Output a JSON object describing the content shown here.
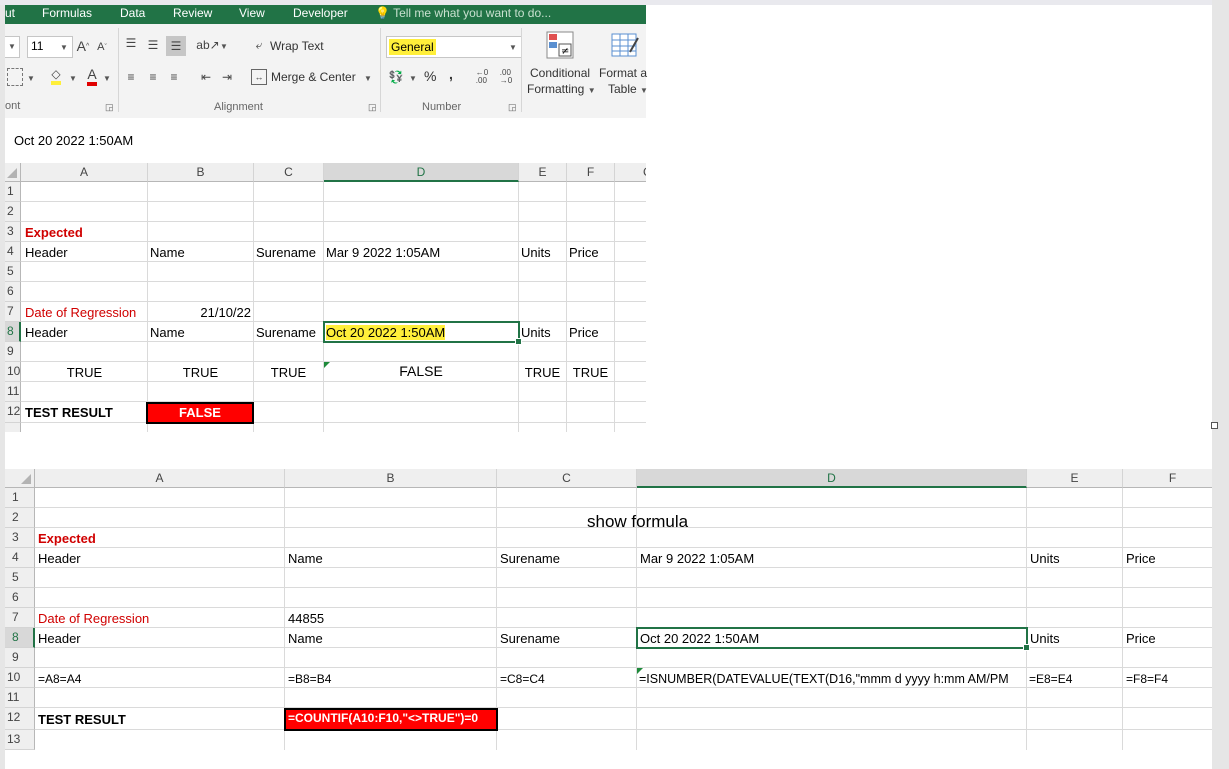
{
  "ribbon": {
    "tabs": [
      "ut",
      "Formulas",
      "Data",
      "Review",
      "View",
      "Developer"
    ],
    "tell_me": "Tell me what you want to do...",
    "font_size": "11",
    "wrap_text": "Wrap Text",
    "merge_center": "Merge & Center",
    "number_format": "General",
    "conditional_formatting_1": "Conditional",
    "conditional_formatting_2": "Formatting",
    "format_as_table_1": "Format a",
    "format_as_table_2": "Table",
    "group_font": "ont",
    "group_alignment": "Alignment",
    "group_number": "Number",
    "percent": "%",
    "comma": ","
  },
  "formula_bar": {
    "value": "Oct 20 2022 1:50AM"
  },
  "sheet1": {
    "columns": [
      "A",
      "B",
      "C",
      "D",
      "E",
      "F",
      "G"
    ],
    "rows": [
      "1",
      "2",
      "3",
      "4",
      "5",
      "6",
      "7",
      "8",
      "9",
      "10",
      "11",
      "12"
    ],
    "a3": "Expected",
    "a4": "Header",
    "b4": "Name",
    "c4": "Surename",
    "d4": "Mar 9 2022 1:05AM",
    "e4": "Units",
    "f4": "Price",
    "a7": "Date of Regression",
    "b7": "21/10/22",
    "a8": "Header",
    "b8": "Name",
    "c8": "Surename",
    "d8": "Oct 20 2022 1:50AM",
    "e8": "Units",
    "f8": "Price",
    "a10": "TRUE",
    "b10": "TRUE",
    "c10": "TRUE",
    "d10": "FALSE",
    "e10": "TRUE",
    "f10": "TRUE",
    "a12": "TEST RESULT",
    "b12": "FALSE"
  },
  "sheet2": {
    "columns": [
      "A",
      "B",
      "C",
      "D",
      "E",
      "F"
    ],
    "rows": [
      "1",
      "2",
      "3",
      "4",
      "5",
      "6",
      "7",
      "8",
      "9",
      "10",
      "11",
      "12",
      "13"
    ],
    "c2": "show formula",
    "a3": "Expected",
    "a4": "Header",
    "b4": "Name",
    "c4": "Surename",
    "d4": "Mar 9 2022 1:05AM",
    "e4": "Units",
    "f4": "Price",
    "a7": "Date of Regression",
    "b7": "44855",
    "a8": "Header",
    "b8": "Name",
    "c8": "Surename",
    "d8": "Oct 20 2022 1:50AM",
    "e8": "Units",
    "f8": "Price",
    "a10": "=A8=A4",
    "b10": "=B8=B4",
    "c10": "=C8=C4",
    "d10": "=ISNUMBER(DATEVALUE(TEXT(D16,\"mmm d yyyy h:mm AM/PM",
    "e10": "=E8=E4",
    "f10": "=F8=F4",
    "a12": "TEST RESULT",
    "b12": "=COUNTIF(A10:F10,\"<>TRUE\")=0"
  },
  "colors": {
    "excel_green": "#217346",
    "highlight_yellow": "#ffef3a",
    "fail_red": "#ff0000",
    "label_red": "#d00000"
  }
}
